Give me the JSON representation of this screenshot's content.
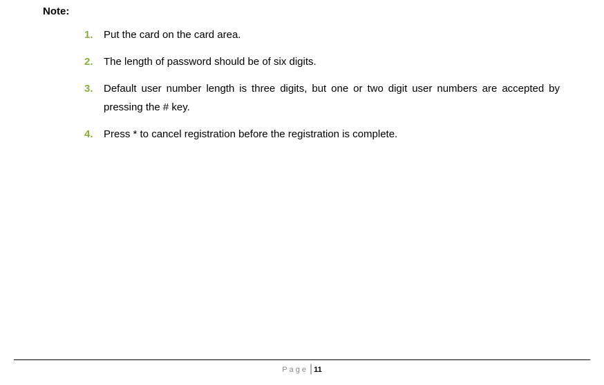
{
  "note_heading": "Note:",
  "items": [
    {
      "num": "1.",
      "text": "Put the card on the card area."
    },
    {
      "num": "2.",
      "text": "The length of password should be of six digits."
    },
    {
      "num": "3.",
      "text": "Default user number length is three digits, but one or two digit user numbers are accepted by pressing the # key."
    },
    {
      "num": "4.",
      "text": "Press * to cancel registration before the registration is complete."
    }
  ],
  "footer": {
    "label": "Page",
    "divider": "|",
    "page_number": "11"
  }
}
